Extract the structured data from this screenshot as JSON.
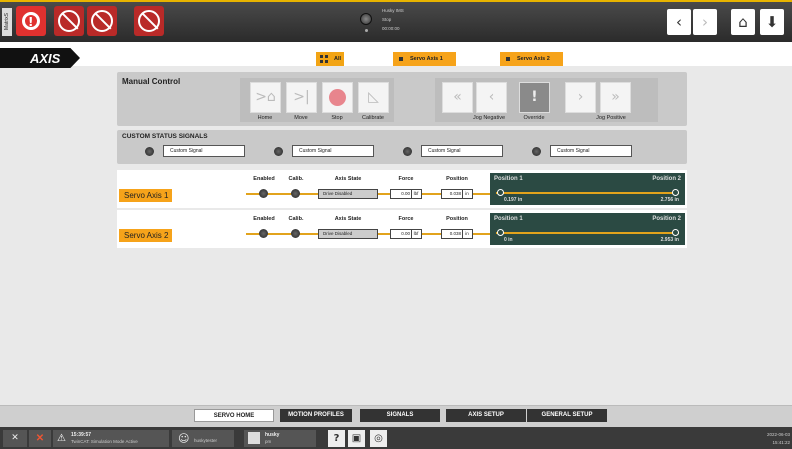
{
  "sidebar": {
    "label": "MatrixS"
  },
  "topbar": {
    "status_lines": [
      "Husky IMS",
      "Stop",
      "00:00:00"
    ]
  },
  "header": {
    "title": "AXIS",
    "filters": [
      {
        "label": "All"
      },
      {
        "label": "Servo Axis 1"
      },
      {
        "label": "Servo Axis 2"
      }
    ]
  },
  "manual": {
    "title": "Manual Control",
    "buttons": [
      {
        "label": "Home",
        "icon": "home-arrow-icon"
      },
      {
        "label": "Move",
        "icon": "move-icon"
      },
      {
        "label": "Stop",
        "icon": "stop-icon"
      },
      {
        "label": "Calibrate",
        "icon": "calibrate-icon"
      },
      {
        "label": "Jog Negative",
        "icon": "double-chevron-left-icon"
      },
      {
        "label": "Override",
        "icon": "override-icon"
      },
      {
        "label": "Jog Positive",
        "icon": "double-chevron-right-icon"
      }
    ]
  },
  "signals": {
    "title": "CUSTOM STATUS SIGNALS",
    "items": [
      "Custom Signal",
      "Custom Signal",
      "Custom Signal",
      "Custom Signal"
    ]
  },
  "axes_headers": {
    "enabled": "Enabled",
    "calib": "Calib.",
    "state": "Axis State",
    "force": "Force",
    "position": "Position",
    "pos1": "Position 1",
    "pos2": "Position 2"
  },
  "axes": [
    {
      "name": "Servo Axis 1",
      "state": "Drive Disabled",
      "force": "0.00",
      "force_unit": "lbf",
      "position": "0.038",
      "position_unit": "in",
      "pos1_value": "0.197 in",
      "pos2_value": "2.756 in"
    },
    {
      "name": "Servo Axis 2",
      "state": "Drive Disabled",
      "force": "0.00",
      "force_unit": "lbf",
      "position": "0.038",
      "position_unit": "in",
      "pos1_value": "0 in",
      "pos2_value": "2.953 in"
    }
  ],
  "tabs": [
    "SERVO HOME",
    "MOTION PROFILES",
    "SIGNALS",
    "AXIS SETUP",
    "GENERAL SETUP"
  ],
  "statusbar": {
    "warn_time": "15:39:57",
    "warn_text": "TwinCAT: Simulation Mode Active",
    "user": "huskytester",
    "machine_name": "husky",
    "machine_sub": "pm",
    "date": "2022-06-03",
    "time": "15:41:22"
  },
  "colors": {
    "accent": "#f6a31a",
    "alarm": "#e0312f",
    "position_panel": "#2b4a43"
  }
}
